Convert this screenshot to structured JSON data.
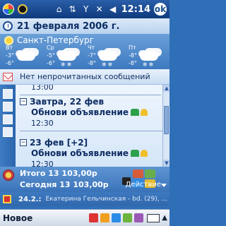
{
  "statusbar": {
    "time": "12:14",
    "icons": [
      "start-icon",
      "app-icon",
      "home-icon",
      "sync-icon",
      "signal-icon",
      "close-icon",
      "volume-icon",
      "ok-icon"
    ],
    "ok_label": "ok"
  },
  "today": {
    "date": "21 февраля 2006 г."
  },
  "weather": {
    "city": "Санкт-Петербург",
    "days": [
      {
        "name": "Вт",
        "hi": "-3°",
        "lo": "-6°",
        "icon": "cloud-sun-icon"
      },
      {
        "name": "Ср",
        "hi": "-5°",
        "lo": "-6°",
        "icon": "cloud-snow-icon"
      },
      {
        "name": "Чт",
        "hi": "-7°",
        "lo": "-8°",
        "icon": "cloud-snow-icon"
      },
      {
        "name": "Пт",
        "hi": "-8°",
        "lo": "-8°",
        "icon": "cloud-snow-icon"
      }
    ]
  },
  "messages": {
    "text": "Нет непрочитанных сообщений"
  },
  "calendar": {
    "top_time": "13:00",
    "groups": [
      {
        "header": "Завтра, 22 фев",
        "toggle": "−",
        "item": {
          "title": "Обнови объявление",
          "time": "12:30"
        }
      },
      {
        "header": "23 фев [+2]",
        "toggle": "−",
        "item": {
          "title": "Обнови объявление",
          "time": "12:30"
        }
      }
    ]
  },
  "totals": {
    "total_line": "Итого 13 103,00р",
    "today_line": "Сегодня 13 103,00р",
    "action_label": "Действие"
  },
  "birthday": {
    "date": "24.2.:",
    "text": "Екатерина Гельчинская - bd. (29), ..."
  },
  "cmdbar": {
    "new_label": "Новое"
  }
}
